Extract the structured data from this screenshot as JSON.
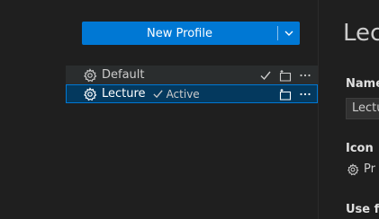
{
  "new_profile": {
    "label": "New Profile"
  },
  "profiles": [
    {
      "name": "Default",
      "active": false
    },
    {
      "name": "Lecture",
      "active": true,
      "active_label": "Active"
    }
  ],
  "details": {
    "title": "Lecture",
    "name_label": "Name",
    "name_value": "Lecture",
    "icon_label": "Icon",
    "icon_value": "Pr",
    "use_for_label": "Use fo"
  },
  "colors": {
    "accent": "#0078d4",
    "selected_bg": "#04395e",
    "background": "#1f1f1f"
  }
}
